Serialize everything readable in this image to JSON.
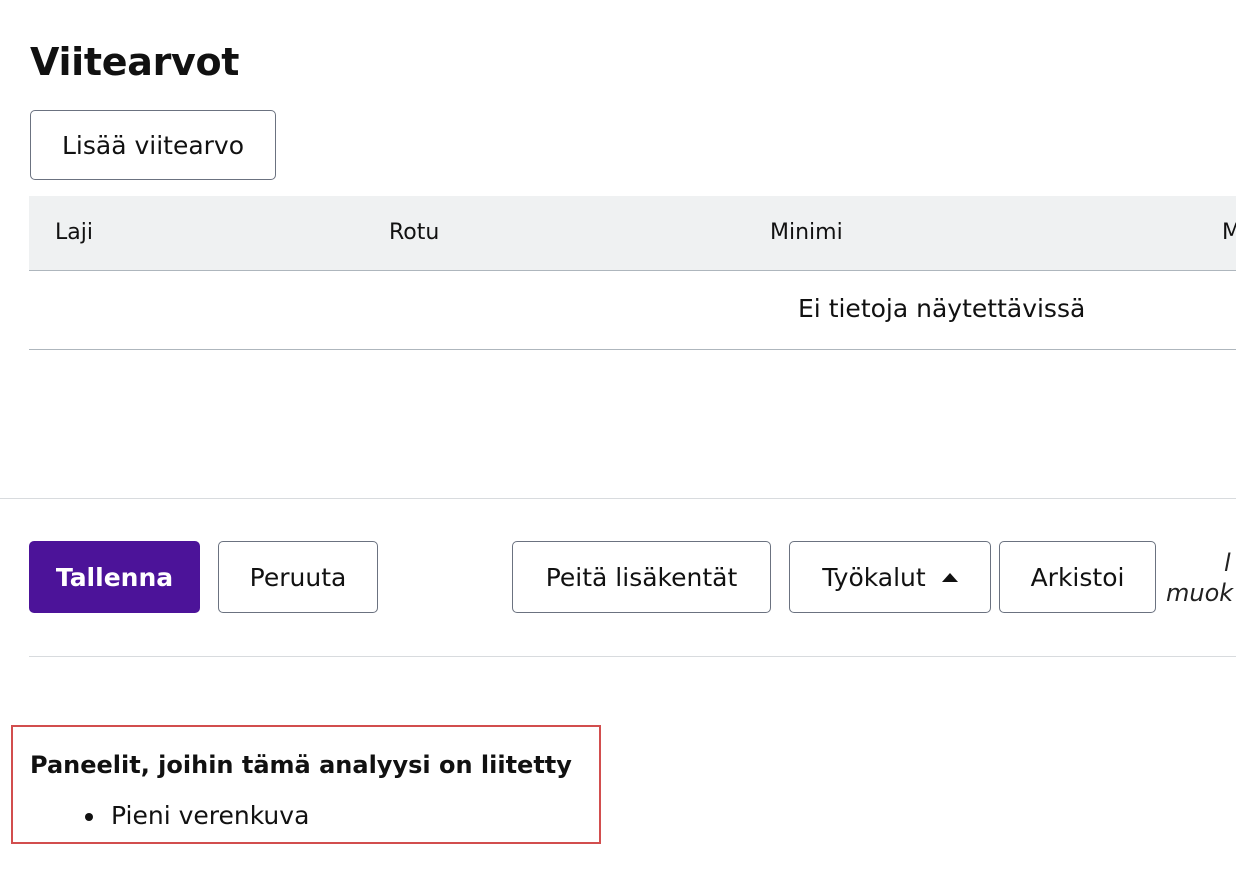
{
  "section": {
    "title": "Viitearvot",
    "add_button": "Lisää viitearvo"
  },
  "table": {
    "columns": [
      "Laji",
      "Rotu",
      "Minimi",
      "M"
    ],
    "empty_text": "Ei tietoja näytettävissä"
  },
  "actions": {
    "save": "Tallenna",
    "cancel": "Peruuta",
    "hide_fields": "Peitä lisäkentät",
    "tools": "Työkalut",
    "tools_icon": "caret-up-icon",
    "archive": "Arkistoi"
  },
  "meta": {
    "line1": "l",
    "line2": "muok"
  },
  "panels": {
    "title": "Paneelit, joihin tämä analyysi on liitetty",
    "items": [
      "Pieni verenkuva"
    ]
  },
  "colors": {
    "primary": "#4c1399",
    "highlight_border": "#d24e4e",
    "table_header_bg": "#eff1f2"
  }
}
